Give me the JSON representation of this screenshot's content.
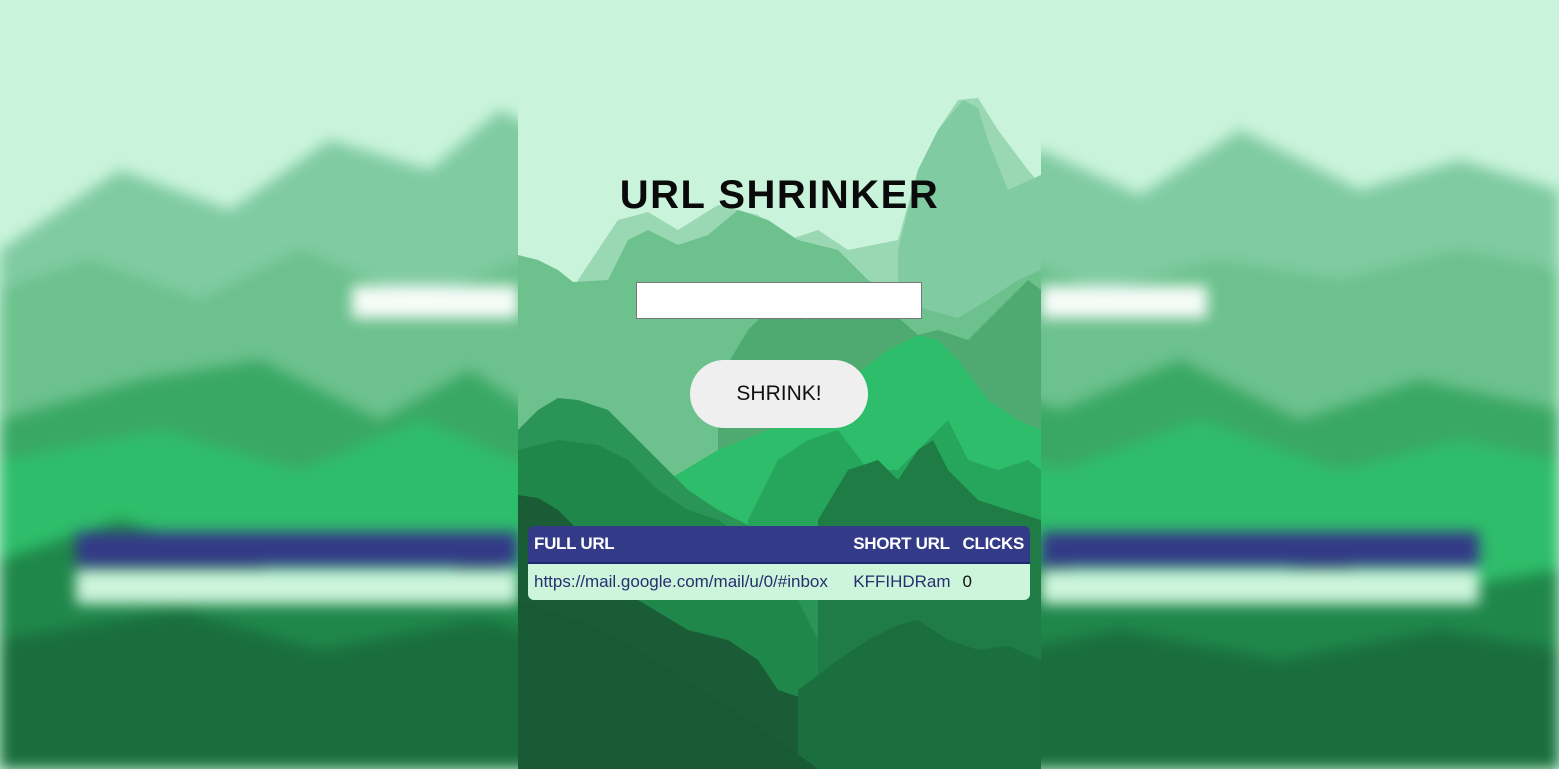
{
  "page": {
    "title": "URL SHRINKER",
    "colors": {
      "sky": "#c9f4db",
      "table_header": "#333a87",
      "table_row": "#cdf5dc",
      "button": "#efefef"
    }
  },
  "form": {
    "url_value": "",
    "url_placeholder": "",
    "button_label": "SHRINK!"
  },
  "table": {
    "headers": {
      "full": "FULL URL",
      "short": "SHORT URL",
      "clicks": "CLICKS"
    },
    "rows": [
      {
        "full": "https://mail.google.com/mail/u/0/#inbox",
        "short": "KFFIHDRam",
        "clicks": "0"
      }
    ]
  }
}
